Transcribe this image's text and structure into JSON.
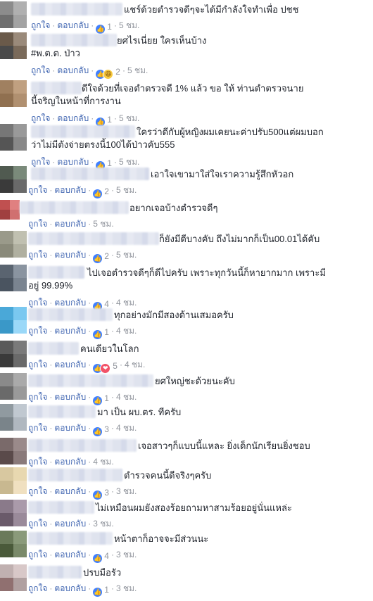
{
  "actions": {
    "like": "ถูกใจ",
    "reply": "ตอบกลับ",
    "dot": "·"
  },
  "reaction_icons": {
    "like": "like-icon",
    "haha": "haha-icon",
    "love": "love-icon"
  },
  "comments": [
    {
      "line1": "แชร์ด้วยตำรวจดีๆจะได้มีกำลังใจทำเพื่อ ปชช",
      "line2": "",
      "reactions": [
        "like"
      ],
      "count": "1",
      "time": "5 ชม."
    },
    {
      "line1": "ยศไรเนี่ยย ใครเห็นบ้าง",
      "line2": "#พ.ต.ต. ป่าว",
      "reactions": [
        "like",
        "haha"
      ],
      "count": "2",
      "time": "5 ชม."
    },
    {
      "line1": "ดีใจด้วยที่เจอตำตรวจดี 1% แล้ว ขอ ให้ ท่านตำตรวจนาย",
      "line2": "นี้จริญในหน้าที่การงาน",
      "reactions": [
        "like"
      ],
      "count": "1",
      "time": "5 ชม."
    },
    {
      "line1": "ใครว่าดีกับผู้หญิงผมเคยนะค่าปรับ500แต่ผมบอก",
      "line2": "ว่าไม่มีตังจ่ายตรงนี้100ได้ป่าวคับ555",
      "reactions": [
        "like"
      ],
      "count": "1",
      "time": "5 ชม."
    },
    {
      "line1": "เอาใจเขามาใส่ใจเราความรู้สึกหัวอก",
      "line2": "",
      "reactions": [
        "like"
      ],
      "count": "2",
      "time": "5 ชม."
    },
    {
      "line1": "อยากเจอบ้างตำรวจดีๆ",
      "line2": "",
      "reactions": [],
      "count": "",
      "time": "5 ชม."
    },
    {
      "line1": "ก็ยังมีดีบางคับ ถึงไม่มากก็เป็น00.01ได้คับ",
      "line2": "",
      "reactions": [
        "like"
      ],
      "count": "2",
      "time": "5 ชม."
    },
    {
      "line1": "ไปเจอตำรวจดีๆก็ดีไปครับ เพราะทุกวันนี้ก็หายากมาก เพราะมี",
      "line2": "อยู่ 99.99%",
      "reactions": [
        "like"
      ],
      "count": "4",
      "time": "4 ชม."
    },
    {
      "line1": "ทุกอย่างมักมีสองด้านเสมอครับ",
      "line2": "",
      "reactions": [
        "like"
      ],
      "count": "1",
      "time": "4 ชม."
    },
    {
      "line1": "คนเดียวในโลก",
      "line2": "",
      "reactions": [
        "like",
        "love"
      ],
      "count": "5",
      "time": "4 ชม."
    },
    {
      "line1": "ยศใหญ่ชะด้วยนะคับ",
      "line2": "",
      "reactions": [
        "like"
      ],
      "count": "1",
      "time": "4 ชม."
    },
    {
      "line1": "มา เป็น ผบ.ตร. ทีครับ",
      "line2": "",
      "reactions": [
        "like"
      ],
      "count": "3",
      "time": "4 ชม."
    },
    {
      "line1": "เจอสาวๆก็แบบนี้แหละ ยิ่งเด็กนักเรียนยิ่งชอบ",
      "line2": "",
      "reactions": [],
      "count": "",
      "time": "4 ชม."
    },
    {
      "line1": "ตำรวจคนนี้ดีจริงๆครับ",
      "line2": "",
      "reactions": [
        "like"
      ],
      "count": "3",
      "time": "3 ชม."
    },
    {
      "line1": "ไม่เหมือนผมยังสองร้อยถามหาสามร้อยอยู่นั่นแหล่ะ",
      "line2": "",
      "reactions": [],
      "count": "",
      "time": "3 ชม."
    },
    {
      "line1": "หน้าตาก็อาจจะมีส่วนนะ",
      "line2": "",
      "reactions": [
        "like"
      ],
      "count": "4",
      "time": "3 ชม."
    },
    {
      "line1": "ปรบมือรัว",
      "line2": "",
      "reactions": [
        "like"
      ],
      "count": "1",
      "time": "3 ชม."
    }
  ]
}
